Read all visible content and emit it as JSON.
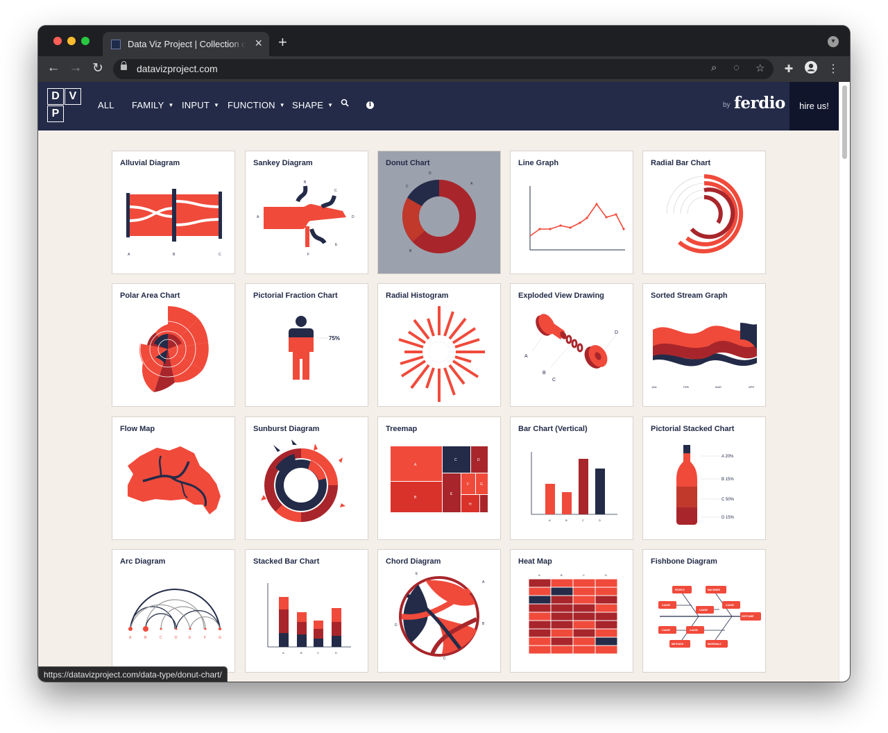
{
  "browser": {
    "tab_title": "Data Viz Project | Collection of data visualizations",
    "tab_close_icon": "×",
    "new_tab_icon": "+",
    "url": "datavizproject.com",
    "status_url": "https://datavizproject.com/data-type/donut-chart/"
  },
  "site": {
    "logo_letters": [
      "D",
      "V",
      "P"
    ],
    "nav": [
      {
        "label": "ALL",
        "dropdown": false
      },
      {
        "label": "FAMILY",
        "dropdown": true
      },
      {
        "label": "INPUT",
        "dropdown": true
      },
      {
        "label": "FUNCTION",
        "dropdown": true
      },
      {
        "label": "SHAPE",
        "dropdown": true
      }
    ],
    "by_label": "by",
    "brand": "ferdio",
    "hire_label": "hire us!"
  },
  "cards": [
    "Alluvial Diagram",
    "Sankey Diagram",
    "Donut Chart",
    "Line Graph",
    "Radial Bar Chart",
    "Polar Area Chart",
    "Pictorial Fraction Chart",
    "Radial Histogram",
    "Exploded View Drawing",
    "Sorted Stream Graph",
    "Flow Map",
    "Sunburst Diagram",
    "Treemap",
    "Bar Chart (Vertical)",
    "Pictorial Stacked Chart",
    "Arc Diagram",
    "Stacked Bar Chart",
    "Chord Diagram",
    "Heat Map",
    "Fishbone Diagram"
  ],
  "card_labels": {
    "alluvial": [
      "A",
      "B",
      "C"
    ],
    "sankey": [
      "A",
      "B",
      "C",
      "D",
      "E",
      "F"
    ],
    "donut": [
      "A",
      "B",
      "C",
      "D"
    ],
    "pictorial_fraction": "75%",
    "exploded": [
      "A",
      "B",
      "C",
      "D"
    ],
    "stream_months": [
      "JAN",
      "FEB",
      "MAR",
      "APR"
    ],
    "treemap": [
      "A",
      "B",
      "C",
      "D",
      "E",
      "F",
      "G",
      "H"
    ],
    "bar_chart": [
      "A",
      "B",
      "C",
      "D"
    ],
    "pictorial_stacked": [
      "A 20%",
      "B 15%",
      "C 50%",
      "D 15%"
    ],
    "arc": [
      "A",
      "B",
      "C",
      "D",
      "E",
      "F",
      "G"
    ],
    "stacked_bar": [
      "A",
      "B",
      "C",
      "D"
    ],
    "chord": [
      "A",
      "B",
      "C",
      "D",
      "E"
    ],
    "heatmap_cols": [
      "A",
      "B",
      "C",
      "D"
    ],
    "fishbone": [
      "PEOPLE",
      "MACHINES",
      "CAUSE",
      "CAUSE",
      "CAUSE",
      "OUTCOME",
      "CAUSE",
      "CAUSE",
      "METHODS",
      "MATERIALS"
    ]
  },
  "colors": {
    "red": "#f04a3b",
    "dark_red": "#a8262b",
    "navy": "#232b48",
    "nav_bg": "#232b48",
    "page_bg": "#f4efe9"
  }
}
